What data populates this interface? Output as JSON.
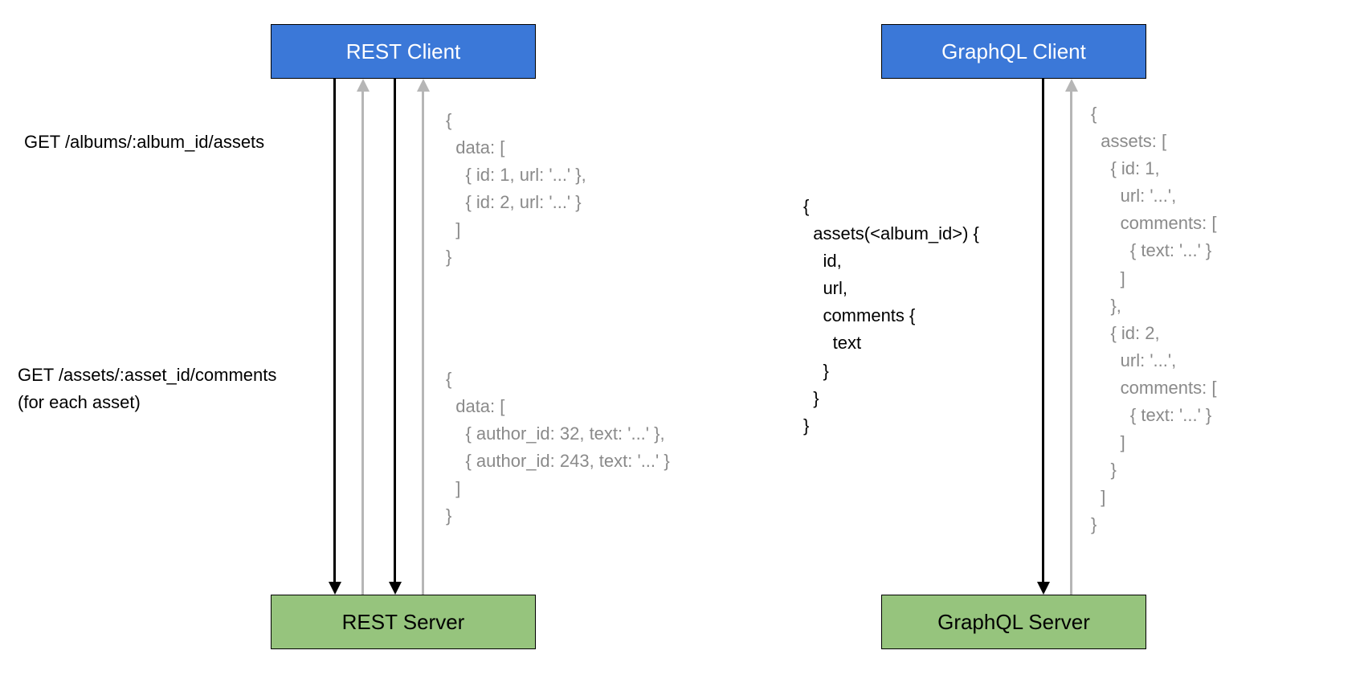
{
  "rest": {
    "client_label": "REST Client",
    "server_label": "REST Server",
    "request1": "GET /albums/:album_id/assets",
    "response1": "{\n  data: [\n    { id: 1, url: '...' },\n    { id: 2, url: '...' }\n  ]\n}",
    "request2_line1": "GET /assets/:asset_id/comments",
    "request2_line2": "(for each asset)",
    "response2": "{\n  data: [\n    { author_id: 32, text: '...' },\n    { author_id: 243, text: '...' }\n  ]\n}"
  },
  "graphql": {
    "client_label": "GraphQL Client",
    "server_label": "GraphQL Server",
    "query": "{\n  assets(<album_id>) {\n    id,\n    url,\n    comments {\n      text\n    }\n  }\n}",
    "response": "{\n  assets: [\n    { id: 1,\n      url: '...',\n      comments: [\n        { text: '...' }\n      ]\n    },\n    { id: 2,\n      url: '...',\n      comments: [\n        { text: '...' }\n      ]\n    }\n  ]\n}"
  }
}
